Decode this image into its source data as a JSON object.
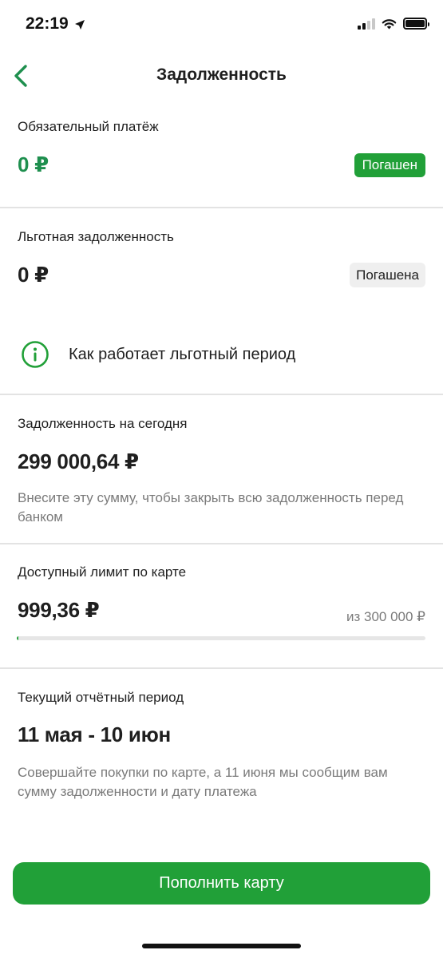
{
  "status_bar": {
    "time": "22:19"
  },
  "header": {
    "title": "Задолженность"
  },
  "mandatory": {
    "label": "Обязательный платёж",
    "amount": "0 ₽",
    "badge": "Погашен"
  },
  "grace_debt": {
    "label": "Льготная задолженность",
    "amount": "0 ₽",
    "badge": "Погашена"
  },
  "info_link": {
    "text": "Как работает льготный период"
  },
  "today_debt": {
    "label": "Задолженность на сегодня",
    "amount": "299 000,64 ₽",
    "hint": "Внесите эту сумму, чтобы закрыть всю задолженность перед банком"
  },
  "limit": {
    "label": "Доступный лимит по карте",
    "amount": "999,36 ₽",
    "of_total": "из 300 000 ₽",
    "fraction": 0.0033
  },
  "period": {
    "label": "Текущий отчётный период",
    "range": "11 мая - 10 июн",
    "hint": "Совершайте покупки по карте, а 11 июня мы сообщим вам сумму задолженности и дату платежа"
  },
  "action": {
    "label": "Пополнить карту"
  },
  "colors": {
    "accent": "#21a038",
    "accent_text": "#1e8f4e",
    "muted": "#7a7a7a",
    "divider": "#e3e3e3"
  }
}
